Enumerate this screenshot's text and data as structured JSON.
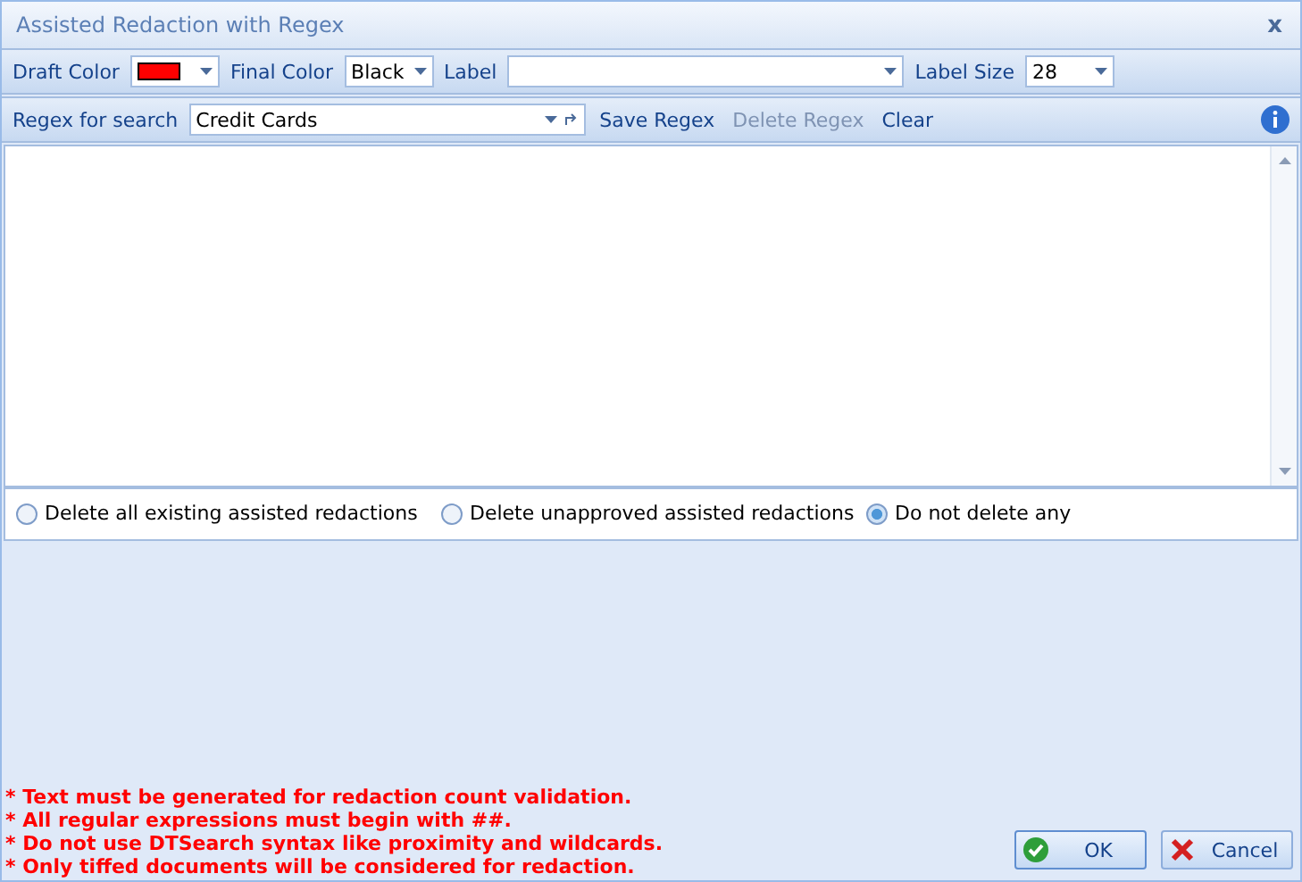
{
  "window": {
    "title": "Assisted Redaction with Regex",
    "close": "x"
  },
  "toolbar": {
    "draft_color": {
      "label": "Draft Color",
      "color": "#ff0000"
    },
    "final_color": {
      "label": "Final Color",
      "value": "Black"
    },
    "label": {
      "label": "Label"
    },
    "label_size": {
      "label": "Label Size",
      "value": "28"
    }
  },
  "search_bar": {
    "label": "Regex for search",
    "value": "Credit Cards",
    "actions": [
      {
        "label": "Save Regex",
        "disabled": false
      },
      {
        "label": "Delete Regex",
        "disabled": true
      },
      {
        "label": "Clear",
        "disabled": false
      }
    ]
  },
  "delete_options": [
    {
      "label": "Delete all existing assisted redactions",
      "selected": false
    },
    {
      "label": "Delete unapproved assisted redactions",
      "selected": false
    },
    {
      "label": "Do not delete any",
      "selected": true
    }
  ],
  "notes": [
    "* Text must be generated for redaction count validation.",
    "* All regular expressions must begin with ##.",
    "* Do not use DTSearch syntax like proximity and wildcards.",
    "* Only tiffed documents will be considered for redaction."
  ],
  "buttons": [
    {
      "kind": "ok",
      "label": "OK"
    },
    {
      "kind": "cancel",
      "label": "Cancel"
    }
  ]
}
